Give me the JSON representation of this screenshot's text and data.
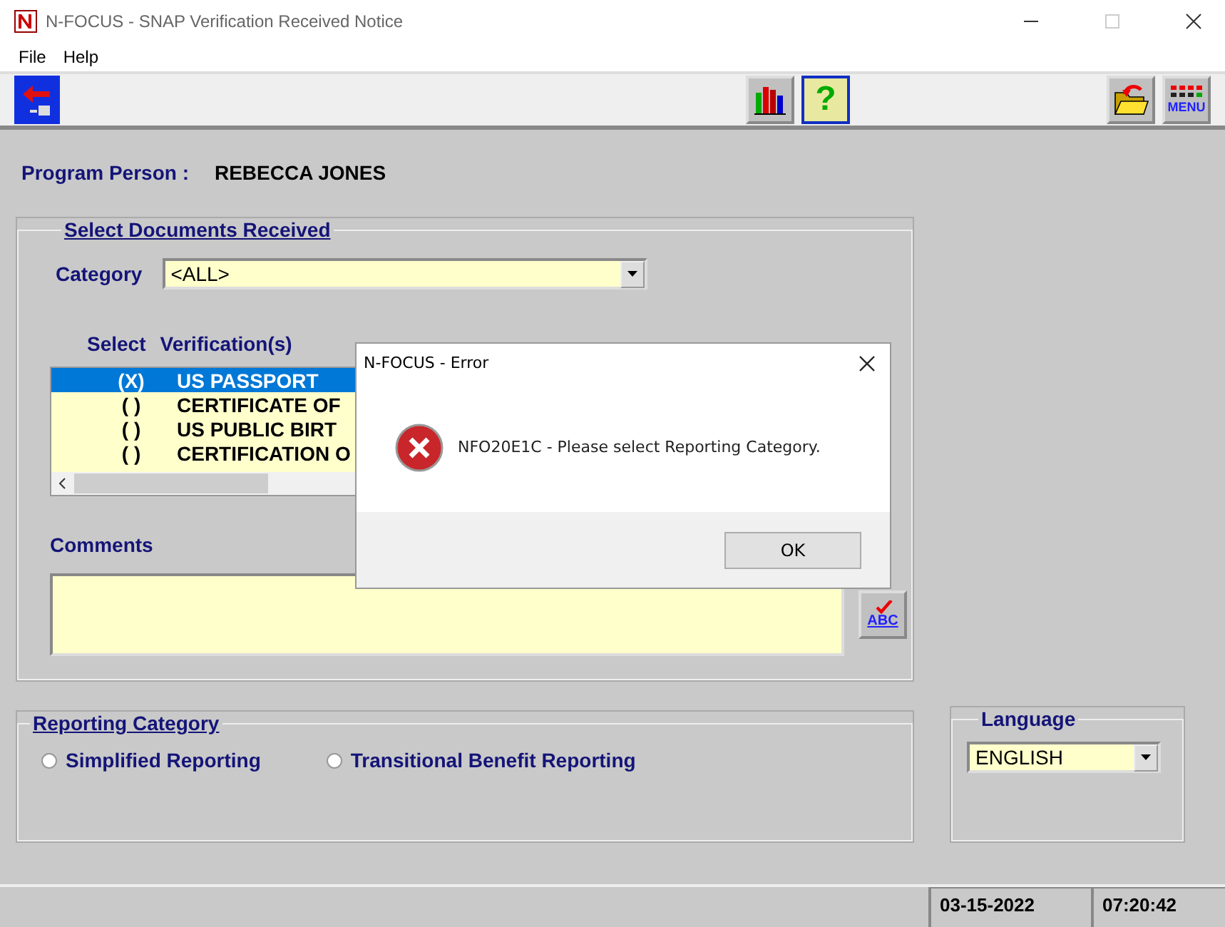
{
  "window": {
    "title": "N-FOCUS - SNAP Verification Received Notice"
  },
  "menu": [
    "File",
    "Help"
  ],
  "toolbar": {
    "help_label": "?",
    "menu_label": "MENU"
  },
  "program_person": {
    "label": "Program Person :",
    "value": "REBECCA JONES"
  },
  "documents": {
    "title": "Select Documents Received",
    "category": {
      "label": "Category",
      "value": "<ALL>"
    },
    "columns": [
      "Select",
      "Verification(s)"
    ],
    "rows": [
      {
        "mark": "(X)",
        "text": "US PASSPORT",
        "selected": true
      },
      {
        "mark": "( )",
        "text": "CERTIFICATE OF",
        "selected": false
      },
      {
        "mark": "( )",
        "text": "US PUBLIC BIRT",
        "selected": false
      },
      {
        "mark": "( )",
        "text": "CERTIFICATION O",
        "selected": false
      }
    ],
    "comments_label": "Comments",
    "spell_label": "ABC"
  },
  "reporting_category": {
    "title": "Reporting Category",
    "options": [
      {
        "label": "Simplified Reporting",
        "selected": false
      },
      {
        "label": "Transitional Benefit Reporting",
        "selected": false
      }
    ]
  },
  "language": {
    "title": "Language",
    "value": "ENGLISH"
  },
  "status_bar": {
    "date": "03-15-2022",
    "time": "07:20:42"
  },
  "dialog": {
    "title": "N-FOCUS - Error",
    "message": "NFO20E1C - Please select Reporting Category.",
    "button": "OK"
  }
}
